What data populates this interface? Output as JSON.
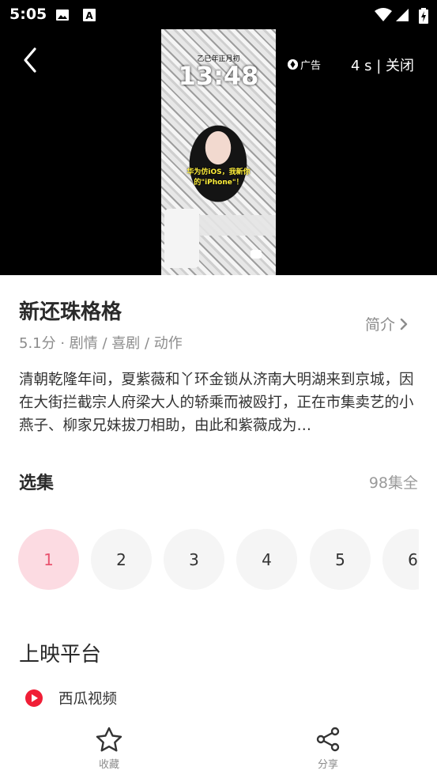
{
  "status_bar": {
    "time": "5:05"
  },
  "video": {
    "thumbnail_texts": {
      "clock": "13:48",
      "date": "乙巳年正月初",
      "caption": "华为仿iOS，我新你的\"iPhone\"！"
    },
    "ad_label": "广告",
    "countdown": "4 s | 关闭"
  },
  "show": {
    "title": "新还珠格格",
    "meta": "5.1分 · 剧情 / 喜剧 / 动作",
    "intro_link": "简介",
    "synopsis": "清朝乾隆年间，夏紫薇和丫环金锁从济南大明湖来到京城，因在大街拦截宗人府梁大人的轿乘而被殴打，正在市集卖艺的小燕子、柳家兄妹拔刀相助，由此和紫薇成为…"
  },
  "episodes": {
    "title": "选集",
    "total": "98集全",
    "items": [
      "1",
      "2",
      "3",
      "4",
      "5",
      "6"
    ],
    "selected": "1"
  },
  "platforms": {
    "title": "上映平台",
    "items": [
      {
        "name": "西瓜视频",
        "icon": "xigua-logo-icon"
      }
    ]
  },
  "bottom_bar": {
    "favorite_label": "收藏",
    "share_label": "分享"
  },
  "colors": {
    "accent": "#e9536f",
    "accent_bg": "#fcdbe2",
    "platform_logo": "#f01e36"
  }
}
